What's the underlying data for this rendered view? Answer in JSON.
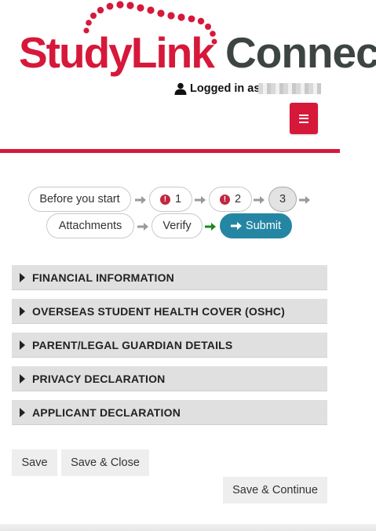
{
  "header": {
    "logo_part1": "StudyLink",
    "logo_part2": "Connect",
    "logged_in_label": "Logged in as",
    "brand_color": "#d6183a"
  },
  "wizard": {
    "steps": [
      {
        "label": "Before you start"
      },
      {
        "label": "1",
        "status": "error"
      },
      {
        "label": "2",
        "status": "error"
      },
      {
        "label": "3",
        "status": "current"
      },
      {
        "label": "Attachments"
      },
      {
        "label": "Verify"
      },
      {
        "label": "Submit",
        "icon": "arrow-right-icon"
      }
    ],
    "accent_color": "#2586a4",
    "error_color": "#c0283f"
  },
  "sections": [
    {
      "label": "FINANCIAL INFORMATION"
    },
    {
      "label": "OVERSEAS STUDENT HEALTH COVER (OSHC)"
    },
    {
      "label": "PARENT/LEGAL GUARDIAN DETAILS"
    },
    {
      "label": "PRIVACY DECLARATION"
    },
    {
      "label": "APPLICANT DECLARATION"
    }
  ],
  "actions": {
    "save": "Save",
    "save_close": "Save & Close",
    "save_continue": "Save & Continue"
  }
}
